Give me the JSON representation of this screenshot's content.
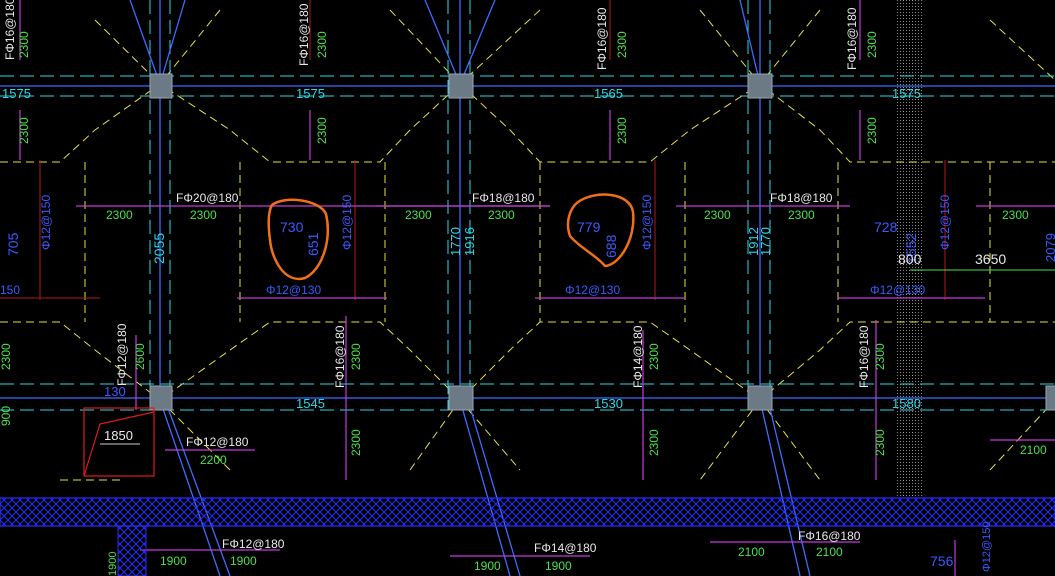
{
  "colors": {
    "background": "#000000",
    "grid_cyan": "#29d8e8",
    "dash_yellow": "#e6e23c",
    "rebar_magenta": "#c13bd6",
    "dim_green": "#4be04b",
    "label_blue": "#3a5bff",
    "annot_orange": "#f07018",
    "hatch_blue": "#2a2cff",
    "red": "#e01a1a",
    "white": "#e9e9e9"
  },
  "labels": {
    "rebar_top": [
      "FΦ16@180",
      "FΦ16@180",
      "FΦ16@180",
      "FΦ16@180"
    ],
    "rebar_mid": [
      "FΦ20@180",
      "FΦ18@180",
      "FΦ18@180"
    ],
    "rebar_lower": [
      "FΦ12@180",
      "FΦ16@180",
      "FΦ14@180",
      "FΦ16@180"
    ],
    "rebar_bottom": [
      "FΦ12@180",
      "FΦ12@180",
      "FΦ14@180",
      "FΦ16@180"
    ],
    "bar_130": [
      "Φ12@130",
      "Φ12@130",
      "Φ12@130"
    ],
    "bar_150": [
      "Φ12@150",
      "Φ12@150",
      "Φ12@150",
      "Φ12@150"
    ],
    "dim_2300": "2300",
    "dim_2600": "2600",
    "dim_2200": "2200",
    "dim_2100": "2100",
    "dim_1900": "1900",
    "dim_900": "900",
    "beam_1575": "1575",
    "beam_1565": "1565",
    "beam_2055": "2055",
    "beam_1545": "1545",
    "beam_1530": "1530",
    "beam_1580": "1580",
    "beam_1770": "1770",
    "beam_1916": "1916",
    "beam_1912": "1912",
    "beam_1552": "1552",
    "beam_2079": "2079",
    "val_705": "705",
    "val_150": "150",
    "val_728": "728",
    "val_756": "756",
    "val_730": "730",
    "val_651": "651",
    "val_779": "779",
    "val_688": "688",
    "val_800": "800",
    "val_3650": "3650",
    "val_1850": "1850",
    "val_130": "130"
  }
}
